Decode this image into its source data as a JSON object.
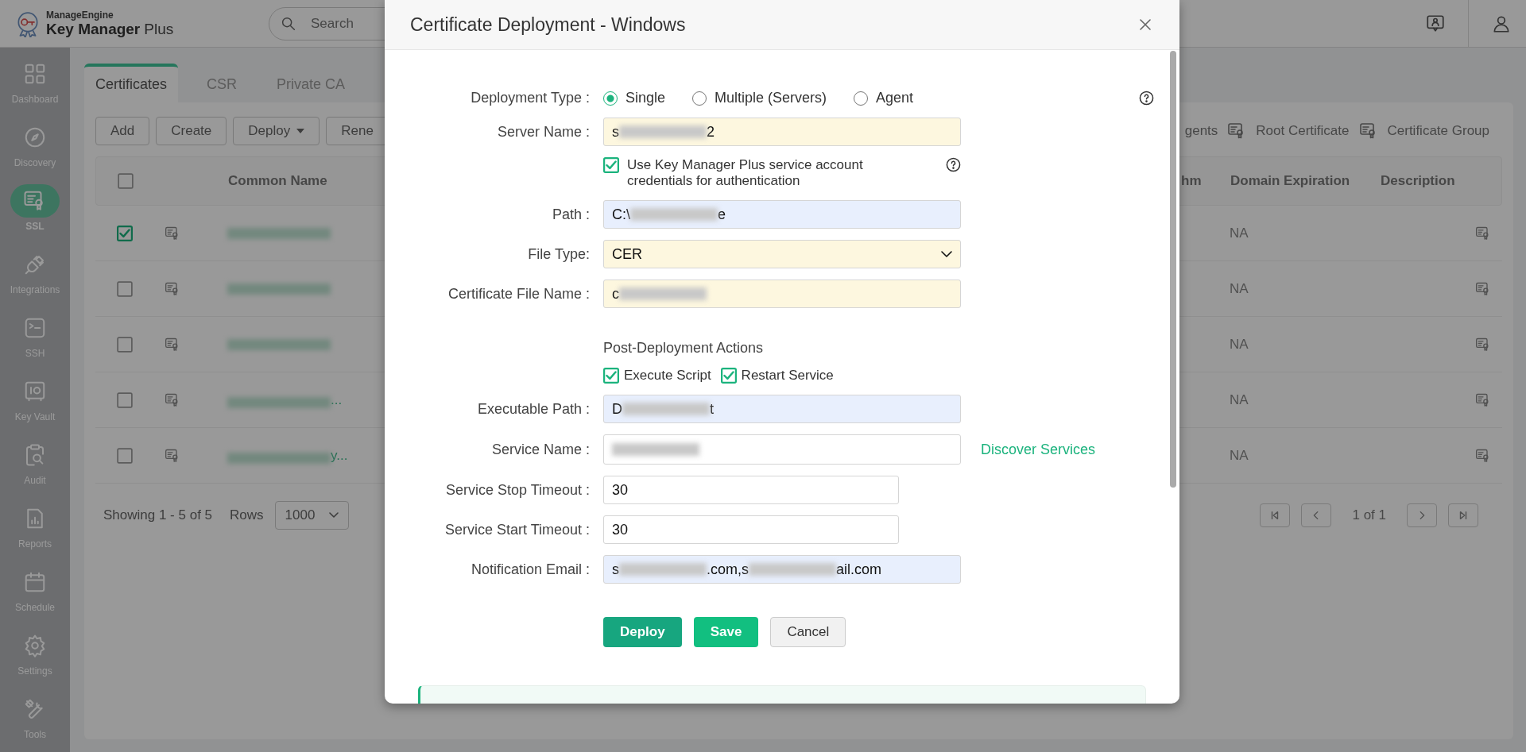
{
  "header": {
    "brand_top": "ManageEngine",
    "brand": "Key Manager",
    "brand_suffix": "Plus",
    "search": {
      "placeholder": "Search"
    }
  },
  "sidebar": {
    "items": [
      {
        "label": "Dashboard",
        "kind": "dashboard",
        "selected": false
      },
      {
        "label": "Discovery",
        "kind": "discovery",
        "selected": false
      },
      {
        "label": "SSL",
        "kind": "ssl",
        "selected": true
      },
      {
        "label": "Integrations",
        "kind": "integrations",
        "selected": false
      },
      {
        "label": "SSH",
        "kind": "ssh",
        "selected": false
      },
      {
        "label": "Key Vault",
        "kind": "vault",
        "selected": false
      },
      {
        "label": "Audit",
        "kind": "audit",
        "selected": false
      },
      {
        "label": "Reports",
        "kind": "reports",
        "selected": false
      },
      {
        "label": "Schedule",
        "kind": "schedule",
        "selected": false
      },
      {
        "label": "Settings",
        "kind": "settings",
        "selected": false
      },
      {
        "label": "Tools",
        "kind": "tools",
        "selected": false
      }
    ]
  },
  "tabs": [
    {
      "label": "Certificates",
      "selected": true
    },
    {
      "label": "CSR",
      "selected": false
    },
    {
      "label": "Private CA",
      "selected": false
    }
  ],
  "toolbar": {
    "buttons": [
      {
        "label": "Add",
        "dropdown": false
      },
      {
        "label": "Create",
        "dropdown": false
      },
      {
        "label": "Deploy",
        "dropdown": true
      },
      {
        "label": "Rene",
        "dropdown": false
      }
    ],
    "links": [
      {
        "label": "gents",
        "icon": false
      },
      {
        "label": "Root Certificate",
        "icon": true
      },
      {
        "label": "Certificate Group",
        "icon": true
      }
    ]
  },
  "table": {
    "select_all_checked": false,
    "columns": [
      "Common Name",
      "hm",
      "Domain Expiration",
      "Description"
    ],
    "rows": [
      {
        "checked": true,
        "domain_expiration": "NA"
      },
      {
        "checked": false,
        "domain_expiration": "NA"
      },
      {
        "checked": false,
        "domain_expiration": "NA"
      },
      {
        "checked": false,
        "name_tail": "...",
        "domain_expiration": "NA"
      },
      {
        "checked": false,
        "name_tail": "y...",
        "domain_expiration": "NA"
      }
    ]
  },
  "pager": {
    "showing": "Showing 1 - 5 of 5",
    "rows_label": "Rows",
    "rows_value": "1000",
    "page": "1 of 1"
  },
  "dialog": {
    "title": "Certificate Deployment - Windows",
    "rows": [
      {
        "kind": "radio",
        "label": "Deployment Type :",
        "help": true,
        "options": [
          {
            "label": "Single",
            "selected": true
          },
          {
            "label": "Multiple (Servers)",
            "selected": false
          },
          {
            "label": "Agent",
            "selected": false
          }
        ]
      },
      {
        "kind": "input",
        "label": "Server Name :",
        "color": "#fdf7df",
        "value": [
          {
            "kind": "text",
            "text": "s"
          },
          {
            "kind": "blur"
          },
          {
            "kind": "text",
            "text": "2"
          }
        ]
      },
      {
        "kind": "checkbox",
        "label": "Use Key Manager Plus service account credentials for authentication",
        "checked": true,
        "help": true
      },
      {
        "kind": "input",
        "label": "Path :",
        "color": "#e8effd",
        "value": [
          {
            "kind": "text",
            "text": "C:\\"
          },
          {
            "kind": "blur"
          },
          {
            "kind": "text",
            "text": "e"
          }
        ]
      },
      {
        "kind": "select",
        "label": "File Type:",
        "color": "#fdf7df",
        "value": "CER"
      },
      {
        "kind": "input",
        "label": "Certificate File Name :",
        "color": "#fdf7df",
        "value": [
          {
            "kind": "text",
            "text": "c"
          },
          {
            "kind": "blur"
          }
        ]
      },
      {
        "kind": "heading",
        "text": "Post-Deployment Actions"
      },
      {
        "kind": "checks",
        "options": [
          {
            "label": "Execute Script",
            "checked": true
          },
          {
            "label": "Restart Service",
            "checked": true
          }
        ]
      },
      {
        "kind": "input",
        "label": "Executable Path :",
        "color": "#e8effd",
        "value": [
          {
            "kind": "text",
            "text": "D"
          },
          {
            "kind": "blur"
          },
          {
            "kind": "text",
            "text": "t"
          }
        ]
      },
      {
        "kind": "input",
        "label": "Service Name :",
        "color": "#ffffff",
        "value": [
          {
            "kind": "blur"
          }
        ],
        "link": "Discover Services"
      },
      {
        "kind": "input",
        "label": "Service Stop Timeout :",
        "color": "#ffffff",
        "short": true,
        "value": [
          {
            "kind": "text",
            "text": "30"
          }
        ]
      },
      {
        "kind": "input",
        "label": "Service Start Timeout :",
        "color": "#ffffff",
        "short": true,
        "value": [
          {
            "kind": "text",
            "text": "30"
          }
        ]
      },
      {
        "kind": "input",
        "label": "Notification Email :",
        "color": "#e8effd",
        "value": [
          {
            "kind": "text",
            "text": "s"
          },
          {
            "kind": "blur"
          },
          {
            "kind": "text",
            "text": ".com,s"
          },
          {
            "kind": "blur"
          },
          {
            "kind": "text",
            "text": "ail.com"
          }
        ]
      },
      {
        "kind": "buttons",
        "buttons": [
          {
            "label": "Deploy",
            "kind": "primary"
          },
          {
            "label": "Save",
            "kind": "save"
          },
          {
            "label": "Cancel",
            "kind": "plain"
          }
        ]
      }
    ]
  }
}
